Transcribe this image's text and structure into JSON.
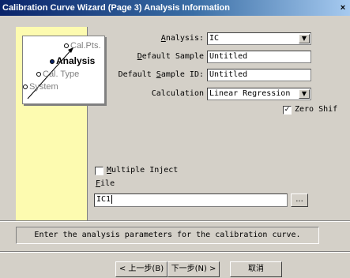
{
  "window": {
    "title": "Calibration Curve Wizard (Page 3) Analysis Information",
    "close": "×"
  },
  "nav": {
    "items": [
      {
        "label": "Cal.Pts.",
        "active": false
      },
      {
        "label": "Analysis",
        "active": true
      },
      {
        "label": "Cal. Type",
        "active": false
      },
      {
        "label": "System",
        "active": false
      }
    ]
  },
  "form": {
    "analysis": {
      "label_pre": "",
      "label_key": "A",
      "label_post": "nalysis:",
      "value": "IC"
    },
    "default_sample": {
      "label_pre": "",
      "label_key": "D",
      "label_post": "efault Sample",
      "value": "Untitled"
    },
    "default_sample_id": {
      "label_pre": "Default ",
      "label_key": "S",
      "label_post": "ample ID:",
      "value": "Untitled"
    },
    "calculation": {
      "label": "Calculation",
      "value": "Linear Regression"
    },
    "zero_shift": {
      "label": "Zero Shif",
      "checked": true,
      "mark": "✓"
    },
    "multiple_inject": {
      "label_key": "M",
      "label_post": "ultiple Inject",
      "checked": false
    },
    "file": {
      "label_key": "F",
      "label_post": "ile",
      "value": "IC1",
      "browse": "..."
    }
  },
  "status": {
    "text": "Enter the analysis parameters for the calibration curve."
  },
  "buttons": {
    "back": "< 上一步(B)",
    "next": "下一步(N) >",
    "cancel": "取消"
  },
  "icons": {
    "dropdown": "▼"
  }
}
